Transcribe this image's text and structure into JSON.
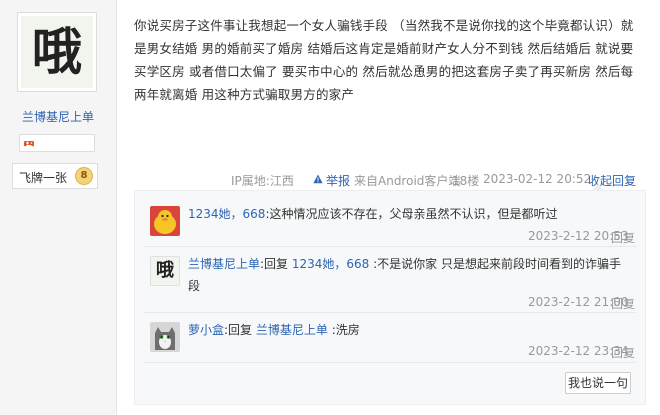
{
  "author": {
    "avatar_glyph": "哦",
    "name": "兰博基尼上单",
    "level_title": "飞牌一张",
    "level": "8"
  },
  "post": {
    "text": "你说买房子这件事让我想起一个女人骗钱手段 （当然我不是说你找的这个毕竟都认识）就是男女结婚 男的婚前买了婚房 结婚后这肯定是婚前财产女人分不到钱 然后结婚后 就说要买学区房 或者借口太偏了 要买市中心的 然后就怂恿男的把这套房子卖了再买新房 然后每两年就离婚 用这种方式骗取男方的家产",
    "ip": "IP属地:江西",
    "report": "举报",
    "client": "来自Android客户端",
    "floor": "18楼",
    "time": "2023-02-12 20:52",
    "collapse": "收起回复"
  },
  "replies": [
    {
      "user": "1234她，668",
      "connector": "",
      "target": "",
      "text": ":这种情况应该不存在，父母亲虽然不认识，但是都听过",
      "time": "2023-2-12 20:53",
      "action": "回复"
    },
    {
      "user": "兰博基尼上单",
      "connector": ":回复 ",
      "target": "1234她，668",
      "text": " :不是说你家 只是想起来前段时间看到的诈骗手段",
      "time": "2023-2-12 21:00",
      "action": "回复"
    },
    {
      "user": "萝小盒",
      "connector": ":回复 ",
      "target": "兰博基尼上单",
      "text": " :洗房",
      "time": "2023-2-12 23:34",
      "action": "回复"
    }
  ],
  "say_button": "我也说一句",
  "colors": {
    "link": "#2d64b3",
    "meta": "#999999"
  }
}
